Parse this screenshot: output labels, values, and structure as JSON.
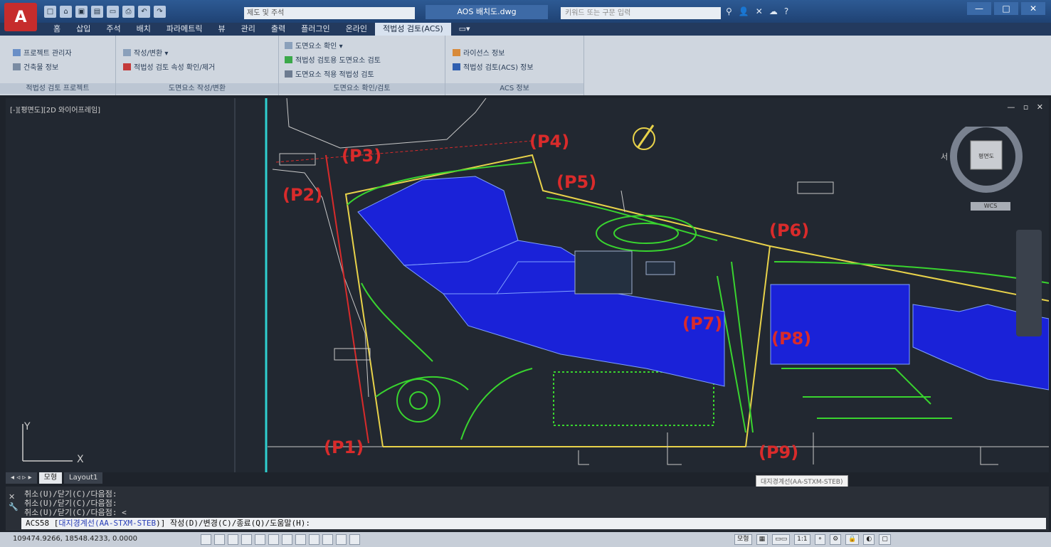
{
  "app": {
    "document_title": "AOS 배치도.dwg",
    "workspace_placeholder": "제도 및 주석",
    "search_placeholder": "키워드 또는 구문 입력"
  },
  "menu": {
    "tabs": [
      "홈",
      "삽입",
      "주석",
      "배치",
      "파라메트릭",
      "뷰",
      "관리",
      "출력",
      "플러그인",
      "온라인",
      "적법성 검토(ACS)"
    ],
    "active_index": 10
  },
  "ribbon": {
    "panel1": {
      "items": [
        "프로젝트 관리자",
        "건축물 정보"
      ],
      "title": "적법성 검토 프로젝트"
    },
    "panel2": {
      "items": [
        "작성/변환",
        "적법성 검토 속성 확인/제거"
      ],
      "title": "도면요소 작성/변환"
    },
    "panel3": {
      "items": [
        "도면요소 확인",
        "적법성 검토용 도면요소 검토",
        "도면요소 적용 적법성 검토"
      ],
      "title": "도면요소 확인/검토"
    },
    "panel4": {
      "items": [
        "라이선스 정보",
        "적법성 검토(ACS) 정보"
      ],
      "title": "ACS 정보"
    }
  },
  "viewport": {
    "label": "[-][평면도][2D 와이어프레임]",
    "viewcube_label": "평면도",
    "viewcube_west": "서",
    "wcs": "WCS"
  },
  "points": [
    "(P1)",
    "(P2)",
    "(P3)",
    "(P4)",
    "(P5)",
    "(P6)",
    "(P7)",
    "(P8)",
    "(P9)"
  ],
  "layout_tabs": [
    "모형",
    "Layout1"
  ],
  "command": {
    "history": [
      "취소(U)/닫기(C)/다음점:",
      "취소(U)/닫기(C)/다음점:",
      "취소(U)/닫기(C)/다음점: <"
    ],
    "input_prefix": "ACS58 [",
    "input_highlight_label": "대지경계선(",
    "input_highlight_code": "AA-STXM-STEB",
    "input_suffix": ")] 작성(D)/변경(C)/종료(Q)/도움말(H):"
  },
  "tooltip": "대지경계선(AA-STXM-STEB)",
  "status": {
    "coords": "109474.9266, 18548.4233, 0.0000",
    "model_label": "모형",
    "scale": "1:1"
  },
  "colors": {
    "accent_red": "#d92b2b",
    "building_blue": "#1a22d8",
    "landscape_green": "#39d42f",
    "boundary_yellow": "#e8d24a"
  }
}
